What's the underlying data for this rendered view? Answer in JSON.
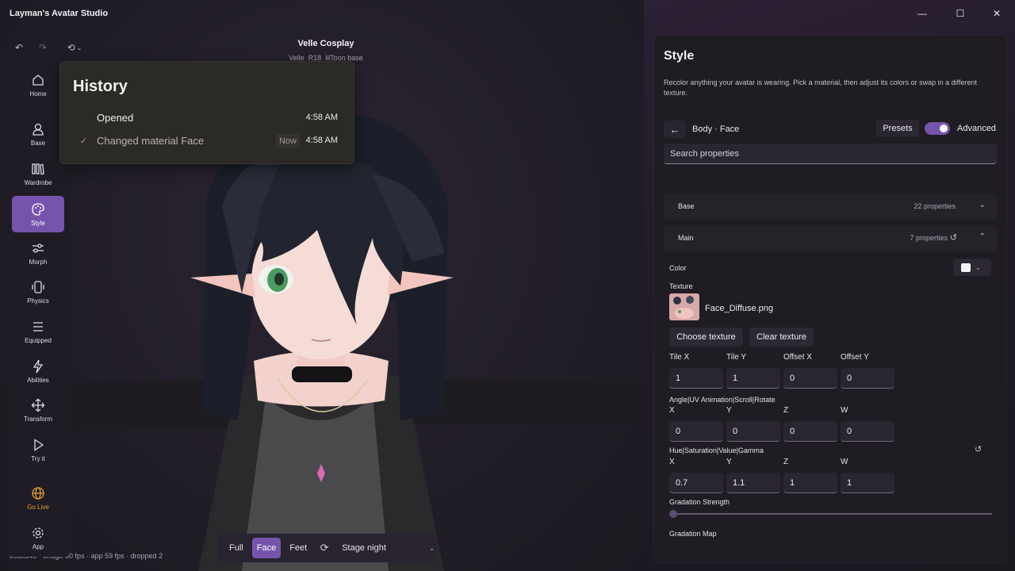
{
  "app": {
    "title": "Layman's Avatar Studio"
  },
  "scene": {
    "title": "Velle Cosplay",
    "subtitle": "Velle_R18_lilToon base"
  },
  "toolbar": {
    "undo_icon": "undo-icon",
    "redo_icon": "redo-icon",
    "history_icon": "history-icon"
  },
  "nav": {
    "items": [
      {
        "label": "Home",
        "icon": "home-icon"
      },
      {
        "label": "Base",
        "icon": "person-icon"
      },
      {
        "label": "Wardrobe",
        "icon": "wardrobe-icon"
      },
      {
        "label": "Style",
        "icon": "palette-icon",
        "active": true
      },
      {
        "label": "Morph",
        "icon": "sliders-icon"
      },
      {
        "label": "Physics",
        "icon": "physics-icon"
      },
      {
        "label": "Equipped",
        "icon": "list-icon"
      },
      {
        "label": "Abilities",
        "icon": "lightning-icon"
      },
      {
        "label": "Transform",
        "icon": "move-icon"
      },
      {
        "label": "Try it",
        "icon": "play-icon"
      },
      {
        "label": "Go Live",
        "icon": "globe-icon",
        "accent": "#e5a227"
      },
      {
        "label": "App",
        "icon": "gear-icon"
      }
    ]
  },
  "history": {
    "title": "History",
    "entries": [
      {
        "label": "Opened",
        "time": "4:58 AM"
      },
      {
        "label": "Changed material Face",
        "badge": "Now",
        "time": "4:58 AM",
        "checked": true
      }
    ]
  },
  "viewbar": {
    "modes": [
      "Full",
      "Face",
      "Feet"
    ],
    "active_mode": "Face",
    "environment": "Stage night"
  },
  "status": {
    "line": "608x540 · bridge 60 fps · app 59 fps · dropped 2"
  },
  "panel": {
    "title": "Style",
    "description": "Recolor anything your avatar is wearing. Pick a material, then adjust its colors or swap in a different texture.",
    "breadcrumb": "Body · Face",
    "presets_label": "Presets",
    "advanced_label": "Advanced",
    "advanced_on": true,
    "search_placeholder": "Search properties",
    "sections": [
      {
        "title": "Base",
        "count": "22 properties",
        "expanded": false
      },
      {
        "title": "Main",
        "count": "7 properties",
        "expanded": true
      }
    ],
    "color_label": "Color",
    "color_value": "#f3f1f4",
    "texture_label": "Texture",
    "texture_file": "Face_Diffuse.png",
    "choose_texture": "Choose texture",
    "clear_texture": "Clear texture",
    "tile": {
      "labels": [
        "Tile X",
        "Tile Y",
        "Offset X",
        "Offset Y"
      ],
      "values": [
        "1",
        "1",
        "0",
        "0"
      ]
    },
    "angle": {
      "title": "Angle|UV Animation|Scroll|Rotate",
      "labels": [
        "X",
        "Y",
        "Z",
        "W"
      ],
      "values": [
        "0",
        "0",
        "0",
        "0"
      ]
    },
    "hsv": {
      "title": "Hue|Saturation|Value|Gamma",
      "labels": [
        "X",
        "Y",
        "Z",
        "W"
      ],
      "values": [
        "0.7",
        "1.1",
        "1",
        "1"
      ]
    },
    "gradation_strength_label": "Gradation Strength",
    "gradation_strength_value": 0,
    "gradation_map_label": "Gradation Map"
  },
  "colors": {
    "accent": "#7654ad",
    "golive": "#e5a227"
  }
}
